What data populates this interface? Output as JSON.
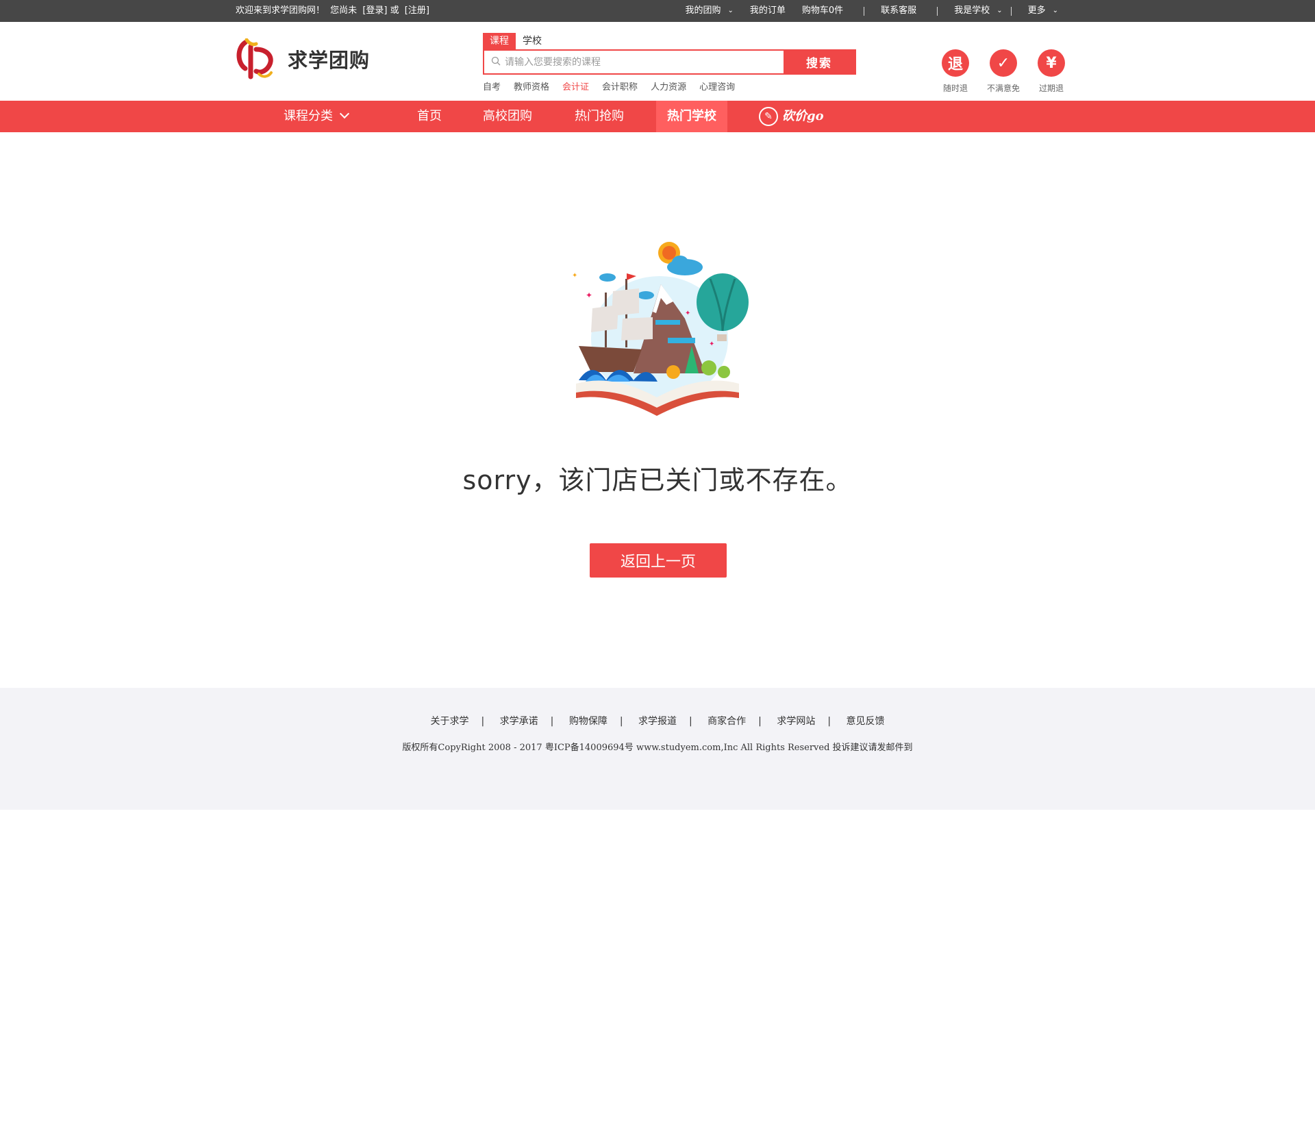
{
  "topbar": {
    "welcome": "欢迎来到求学团购网！",
    "not_logged": "您尚未",
    "login": "[登录]",
    "or": "或",
    "register": "[注册]",
    "my_group": "我的团购",
    "my_orders": "我的订单",
    "cart": "购物车0件",
    "contact": "联系客服",
    "i_am_school": "我是学校",
    "more": "更多"
  },
  "header": {
    "brand": "求学团购",
    "search": {
      "tabs": [
        "课程",
        "学校"
      ],
      "placeholder": "请输入您要搜索的课程",
      "button": "搜索",
      "hot": [
        "自考",
        "教师资格",
        "会计证",
        "会计职称",
        "人力资源",
        "心理咨询"
      ],
      "highlight_index": 2
    },
    "guarantees": [
      {
        "icon": "refund-icon",
        "glyph": "退",
        "label": "随时退"
      },
      {
        "icon": "check-icon",
        "glyph": "✓",
        "label": "不满意免"
      },
      {
        "icon": "expired-refund-icon",
        "glyph": "¥",
        "label": "过期退"
      }
    ]
  },
  "nav": {
    "category": "课程分类",
    "items": [
      "首页",
      "高校团购",
      "热门抢购",
      "热门学校"
    ],
    "active": "热门学校",
    "kanjia": "砍价go"
  },
  "main": {
    "message": "sorry，该门店已关门或不存在。",
    "back_button": "返回上一页"
  },
  "footer": {
    "links": [
      "关于求学",
      "求学承诺",
      "购物保障",
      "求学报道",
      "商家合作",
      "求学网站",
      "意见反馈"
    ],
    "copyright": "版权所有CopyRight 2008 - 2017 粤ICP备14009694号 www.studyem.com,Inc All Rights Reserved 投诉建议请发邮件到"
  },
  "colors": {
    "accent": "#f04747",
    "topbar": "#474747",
    "footer_bg": "#f3f3f7"
  }
}
